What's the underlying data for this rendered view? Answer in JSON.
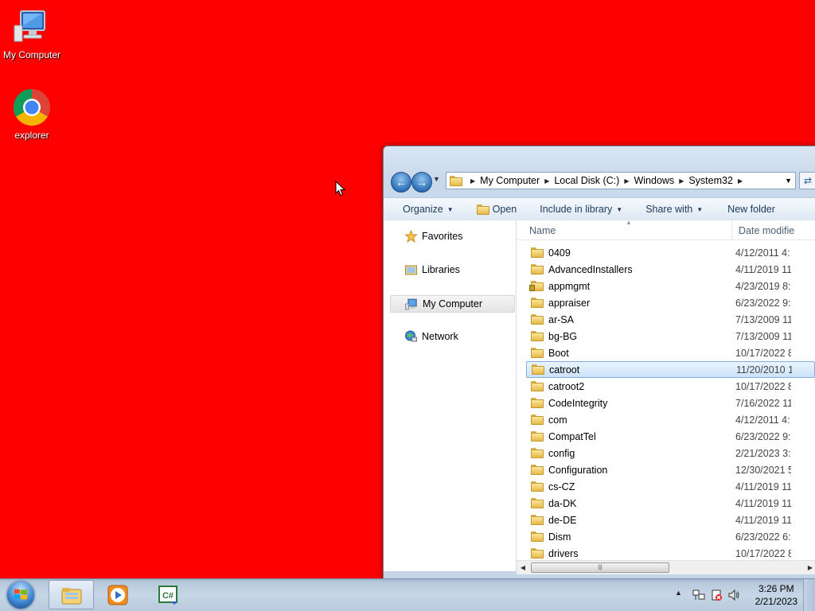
{
  "desktop": {
    "icons": [
      {
        "label": "My Computer",
        "icon": "computer-icon"
      },
      {
        "label": "explorer",
        "icon": "chrome-icon"
      }
    ],
    "background_color": "#ff0000"
  },
  "explorer": {
    "address": {
      "crumbs": [
        "My Computer",
        "Local Disk (C:)",
        "Windows",
        "System32"
      ]
    },
    "toolbar": {
      "organize": "Organize",
      "open": "Open",
      "include_in_library": "Include in library",
      "share_with": "Share with",
      "new_folder": "New folder"
    },
    "nav": {
      "favorites": "Favorites",
      "libraries": "Libraries",
      "my_computer": "My Computer",
      "network": "Network"
    },
    "columns": {
      "name": "Name",
      "date": "Date modifie"
    },
    "files": [
      {
        "name": "0409",
        "date": "4/12/2011 4:"
      },
      {
        "name": "AdvancedInstallers",
        "date": "4/11/2019 11"
      },
      {
        "name": "appmgmt",
        "date": "4/23/2019 8:",
        "locked": true
      },
      {
        "name": "appraiser",
        "date": "6/23/2022 9:"
      },
      {
        "name": "ar-SA",
        "date": "7/13/2009 11"
      },
      {
        "name": "bg-BG",
        "date": "7/13/2009 11"
      },
      {
        "name": "Boot",
        "date": "10/17/2022 8"
      },
      {
        "name": "catroot",
        "date": "11/20/2010 1",
        "selected": true
      },
      {
        "name": "catroot2",
        "date": "10/17/2022 8"
      },
      {
        "name": "CodeIntegrity",
        "date": "7/16/2022 11"
      },
      {
        "name": "com",
        "date": "4/12/2011 4:"
      },
      {
        "name": "CompatTel",
        "date": "6/23/2022 9:"
      },
      {
        "name": "config",
        "date": "2/21/2023 3:"
      },
      {
        "name": "Configuration",
        "date": "12/30/2021 5"
      },
      {
        "name": "cs-CZ",
        "date": "4/11/2019 11"
      },
      {
        "name": "da-DK",
        "date": "4/11/2019 11"
      },
      {
        "name": "de-DE",
        "date": "4/11/2019 11"
      },
      {
        "name": "Dism",
        "date": "6/23/2022 6:"
      },
      {
        "name": "drivers",
        "date": "10/17/2022 8"
      }
    ]
  },
  "taskbar": {
    "clock_time": "3:26 PM",
    "clock_date": "2/21/2023",
    "buttons": [
      "explorer-icon",
      "media-player-icon",
      "csharp-icon"
    ]
  }
}
